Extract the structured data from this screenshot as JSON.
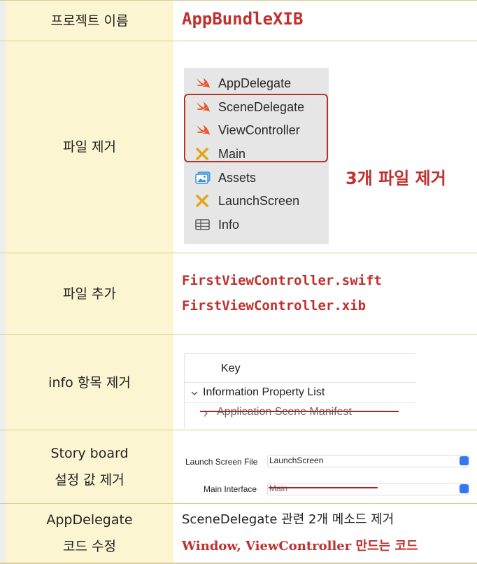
{
  "rows": [
    {
      "label": "프로젝트 이름",
      "project_name": "AppBundleXIB"
    },
    {
      "label": "파일 제거",
      "files": [
        {
          "name": "AppDelegate",
          "icon": "swift-icon"
        },
        {
          "name": "SceneDelegate",
          "icon": "swift-icon"
        },
        {
          "name": "ViewController",
          "icon": "swift-icon"
        },
        {
          "name": "Main",
          "icon": "interface-builder-icon"
        },
        {
          "name": "Assets",
          "icon": "asset-catalog-icon"
        },
        {
          "name": "LaunchScreen",
          "icon": "interface-builder-icon"
        },
        {
          "name": "Info",
          "icon": "plist-table-icon"
        }
      ],
      "note": "3개 파일 제거"
    },
    {
      "label": "파일 추가",
      "files_added": [
        "FirstViewController.swift",
        "FirstViewController.xib"
      ]
    },
    {
      "label": "info 항목 제거",
      "plist": {
        "header": "Key",
        "root": "Information Property List",
        "removed_item": "Application Scene Manifest"
      }
    },
    {
      "label_lines": [
        "Story board",
        "설정 값 제거"
      ],
      "settings": [
        {
          "name": "Launch Screen File",
          "value": "LaunchScreen"
        },
        {
          "name": "Main Interface",
          "value": "Main"
        }
      ]
    },
    {
      "label_lines": [
        "AppDelegate",
        "코드 수정"
      ],
      "desc": "SceneDelegate 관련 2개 메소드 제거",
      "highlight": "Window, ViewController 만드는 코드"
    }
  ],
  "colors": {
    "label_bg": "#fcf5d2",
    "accent_red": "#c0302e",
    "divider": "#d9cd92",
    "swift": "#e8532c"
  }
}
